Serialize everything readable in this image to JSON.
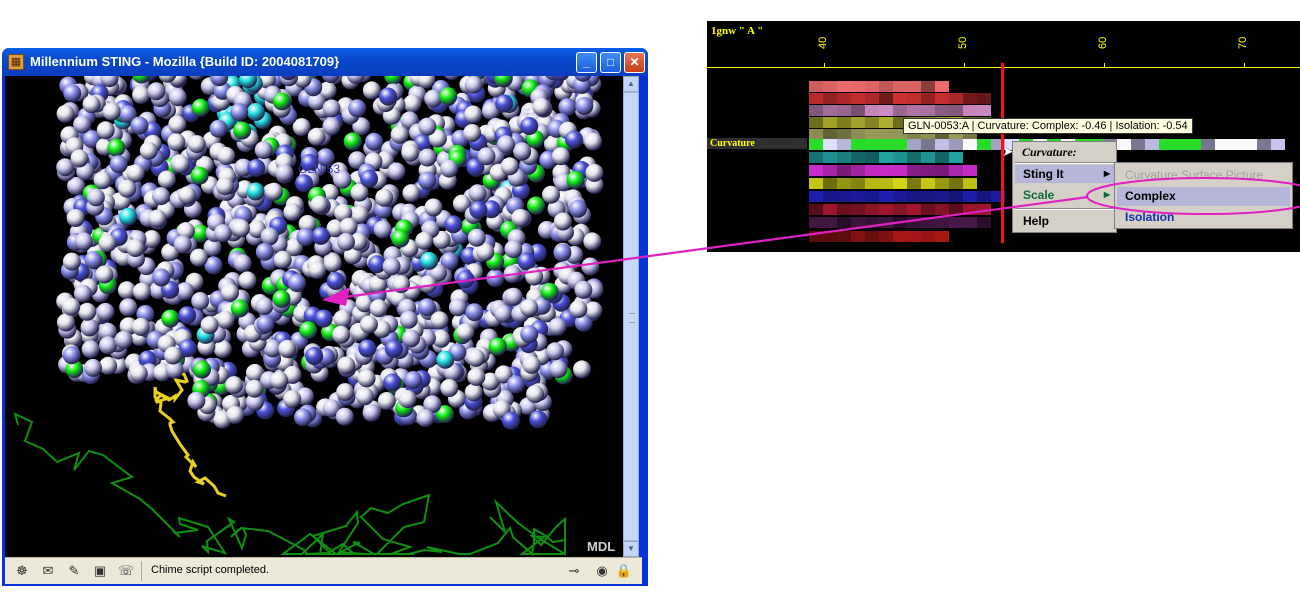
{
  "window": {
    "title": "Millennium STING - Mozilla {Build ID: 2004081709}",
    "controls": {
      "minimize": "_",
      "maximize": "□",
      "close": "✕"
    }
  },
  "viewer": {
    "residue_label": "GLN-53",
    "watermark": "MDL",
    "colors": {
      "background": "#000000",
      "periwinkle": "#8a8ee8",
      "light_lavender": "#c8c8ec",
      "white_gray": "#e4e4ec",
      "blue": "#4a50d8",
      "green": "#10ee10",
      "cyan": "#20e0e0",
      "yellow": "#e8d020",
      "backbone": "#109010"
    }
  },
  "statusbar": {
    "icons": [
      "navigator-icon",
      "mail-icon",
      "composer-icon",
      "address-book-icon",
      "chatzilla-icon"
    ],
    "message": "Chime script completed.",
    "right_icons": [
      "connection-icon",
      "popup-blocker-icon",
      "security-lock-icon"
    ]
  },
  "sequence_panel": {
    "title": "1gnw \" A \"",
    "ticks": [
      "40",
      "50",
      "60",
      "70"
    ],
    "row_label": "Curvature",
    "tooltip": "GLN-0053:A | Curvature: Complex: -0.46 | Isolation: -0.54"
  },
  "context_menu": {
    "header": "Curvature:",
    "items": [
      "Sting It",
      "Scale",
      "Help"
    ]
  },
  "submenu": {
    "items": [
      "Curvature Surface Picture",
      "Complex",
      "Isolation"
    ]
  },
  "annotation": {
    "color": "#e020c0"
  }
}
